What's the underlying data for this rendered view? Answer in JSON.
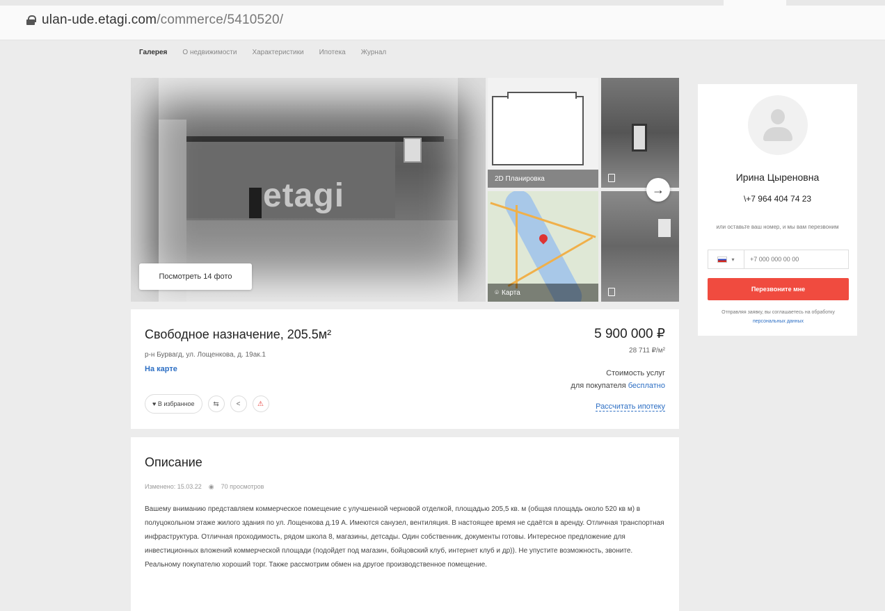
{
  "browser": {
    "url_domain": "ulan-ude.etagi.com",
    "url_path": "/commerce/5410520/"
  },
  "page_nav": [
    "Галерея",
    "О недвижимости",
    "Характеристики",
    "Ипотека",
    "Журнал"
  ],
  "gallery": {
    "watermark": "etagi",
    "view_photos_label": "Посмотреть 14 фото",
    "plan_caption": "2D Планировка",
    "map_caption": "Карта",
    "next_icon": "arrow-right-icon"
  },
  "listing": {
    "title": "Свободное назначение, 205.5м²",
    "address": "р-н Бурвагд, ул. Лощенкова, д. 19ак.1",
    "map_link": "На карте",
    "favorite_label": "♥ В избранное",
    "price": "5 900 000 ₽",
    "price_per_m2": "28 711 ₽/м²",
    "service_cost_label": "Стоимость услуг",
    "buyer_label": "для покупателя",
    "buyer_value": "бесплатно",
    "mortgage_link": "Рассчитать ипотеку"
  },
  "description": {
    "title": "Описание",
    "updated": "Изменено: 15.03.22",
    "views": "70 просмотров",
    "text": "Вашему вниманию представляем коммерческое помещение с улучшенной черновой отделкой, площадью 205,5 кв. м (общая площадь около 520 кв м) в полуцокольном этаже жилого здания по ул. Лощенкова д.19 А. Имеются санузел, вентиляция. В настоящее время не сдаётся в аренду. Отличная транспортная инфраструктура. Отличная проходимость, рядом школа 8, магазины, детсады. Один собственник, документы готовы. Интересное предложение для инвестиционных вложений коммерческой площади (подойдет под магазин, бойцовский клуб, интернет клуб и др)). Не упустите возможность, звоните. Реальному покупателю хороший торг. Также рассмотрим обмен на другое производственное помещение."
  },
  "agent": {
    "name": "Ирина Цыреновна",
    "phone": "\\+7 964 404 74 23",
    "hint": "или оставьте ваш номер, и мы вам перезвоним",
    "country_code_arrow": "▾",
    "phone_placeholder": "+7 000 000 00 00",
    "call_button": "Перезвоните мне",
    "consent_text": "Отправляя заявку, вы соглашаетесь на обработку",
    "consent_link": "персональных данных"
  },
  "colors": {
    "accent_red": "#f04b3f",
    "link_blue": "#2d6fc4"
  }
}
